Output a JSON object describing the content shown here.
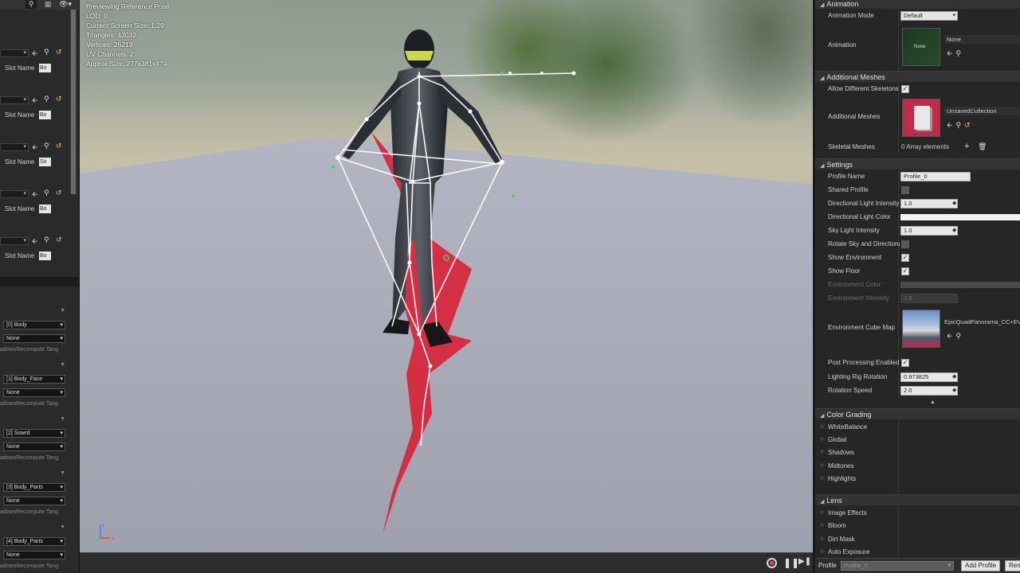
{
  "left": {
    "slot_label": "Slot Name",
    "slots": [
      "Bo",
      "Bo",
      "So",
      "Bo",
      "Bo"
    ],
    "materials": [
      {
        "material": "[0] Body",
        "override": "None",
        "recompute": "adows",
        "recompute_label": "Recompute Tang"
      },
      {
        "material": "[1] Body_Face",
        "override": "None",
        "recompute": "adows",
        "recompute_label": "Recompute Tang"
      },
      {
        "material": "[2] Sowrd",
        "override": "None",
        "recompute": "adows",
        "recompute_label": "Recompute Tang"
      },
      {
        "material": "[3] Body_Parts",
        "override": "None",
        "recompute": "adows",
        "recompute_label": "Recompute Tang"
      },
      {
        "material": "[4] Body_Parts",
        "override": "None",
        "recompute": "adows",
        "recompute_label": "Recompute Tang"
      }
    ]
  },
  "viewport": {
    "mode": "Previewing Reference Pose",
    "lod": "LOD: 0",
    "screen_size": "Current Screen Size: 1.29",
    "triangles": "Triangles: 43032",
    "vertices": "Vertices: 26219",
    "uv_channels": "UV Channels: 2",
    "approx_size": "Approx Size: 277x381x474",
    "axis": {
      "z": "z",
      "x": "x"
    }
  },
  "right": {
    "animation": {
      "title": "Animation",
      "mode_label": "Animation Mode",
      "mode_value": "Default",
      "anim_label": "Animation",
      "anim_thumb": "None",
      "anim_value": "None"
    },
    "additional_meshes": {
      "title": "Additional Meshes",
      "allow_label": "Allow Different Skeletons",
      "meshes_label": "Additional Meshes",
      "meshes_value": "UnsavedCollection",
      "skeletal_label": "Skeletal Meshes",
      "skeletal_value": "0 Array elements"
    },
    "settings": {
      "title": "Settings",
      "profile_name_label": "Profile Name",
      "profile_name_value": "Profile_0",
      "shared_label": "Shared Profile",
      "dir_intensity_label": "Directional Light Intensity",
      "dir_intensity_value": "1.0",
      "dir_color_label": "Directional Light Color",
      "sky_label": "Sky Light Intensity",
      "sky_value": "1.0",
      "rotate_label": "Rotate Sky and Directional",
      "show_env_label": "Show Environment",
      "show_floor_label": "Show Floor",
      "env_color_label": "Environment Color",
      "env_intensity_label": "Environment Intensity",
      "env_intensity_value": "1.0",
      "cube_label": "Environment Cube Map",
      "cube_value": "EpicQuadPanorama_CC+EV1",
      "post_label": "Post Processing Enabled",
      "rig_rot_label": "Lighting Rig Rotation",
      "rig_rot_value": "0.973825",
      "rot_speed_label": "Rotation Speed",
      "rot_speed_value": "2.0"
    },
    "color_grading": {
      "title": "Color Grading",
      "items": [
        "WhiteBalance",
        "Global",
        "Shadows",
        "Midtones",
        "Highlights"
      ]
    },
    "lens": {
      "title": "Lens",
      "items": [
        "Image Effects",
        "Bloom",
        "Dirt Mask",
        "Auto Exposure"
      ]
    },
    "profile_bar": {
      "label": "Profile",
      "value": "Profile_0",
      "add": "Add Profile",
      "remove": "Rem"
    }
  }
}
